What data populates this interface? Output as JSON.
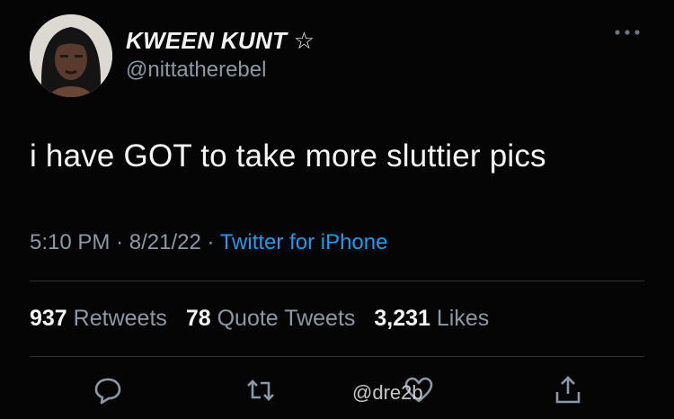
{
  "author": {
    "display_name": "KWEEN KUNT",
    "name_emoji": "☆",
    "handle": "@nittatherebel"
  },
  "tweet": {
    "text": "i have GOT to take more sluttier pics",
    "time": "5:10 PM",
    "date": "8/21/22",
    "source": "Twitter for iPhone",
    "separator": "·"
  },
  "stats": {
    "retweets_count": "937",
    "retweets_label": "Retweets",
    "quotes_count": "78",
    "quotes_label": "Quote Tweets",
    "likes_count": "3,231",
    "likes_label": "Likes"
  },
  "watermark": "@dre2b",
  "colors": {
    "background": "#050505",
    "text": "#f5f5f5",
    "muted": "#8b98a5",
    "link": "#1d9bf0",
    "divider": "#2f3336"
  },
  "icons": [
    "more-options-icon",
    "reply-icon",
    "retweet-icon",
    "like-icon",
    "share-icon"
  ]
}
